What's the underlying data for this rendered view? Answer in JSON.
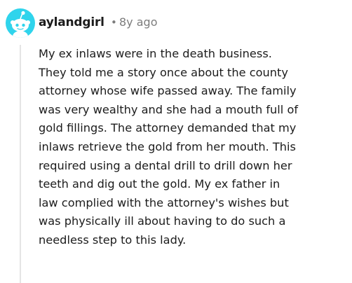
{
  "comment": {
    "username": "aylandgirl",
    "separator": "•",
    "timestamp": "8y ago",
    "avatar_icon": "snoo-avatar-icon",
    "colors": {
      "avatar_bg": "#2fd4ec",
      "text": "#1c1c1c",
      "meta": "#7c7c7c",
      "thread_line": "#e5e5e5"
    },
    "body_lines": [
      "My ex inlaws were in the death business.",
      "They told me a story once about the county",
      "attorney whose wife passed away. The family",
      "was very wealthy and she had a mouth full of",
      "gold fillings. The attorney demanded that my",
      "inlaws retrieve the gold from her mouth. This",
      "required using a dental drill to drill down her",
      "teeth and dig out the gold. My ex father in",
      "law complied with the attorney's wishes but",
      "was physically ill about having to do such a",
      "needless step to this lady."
    ]
  }
}
